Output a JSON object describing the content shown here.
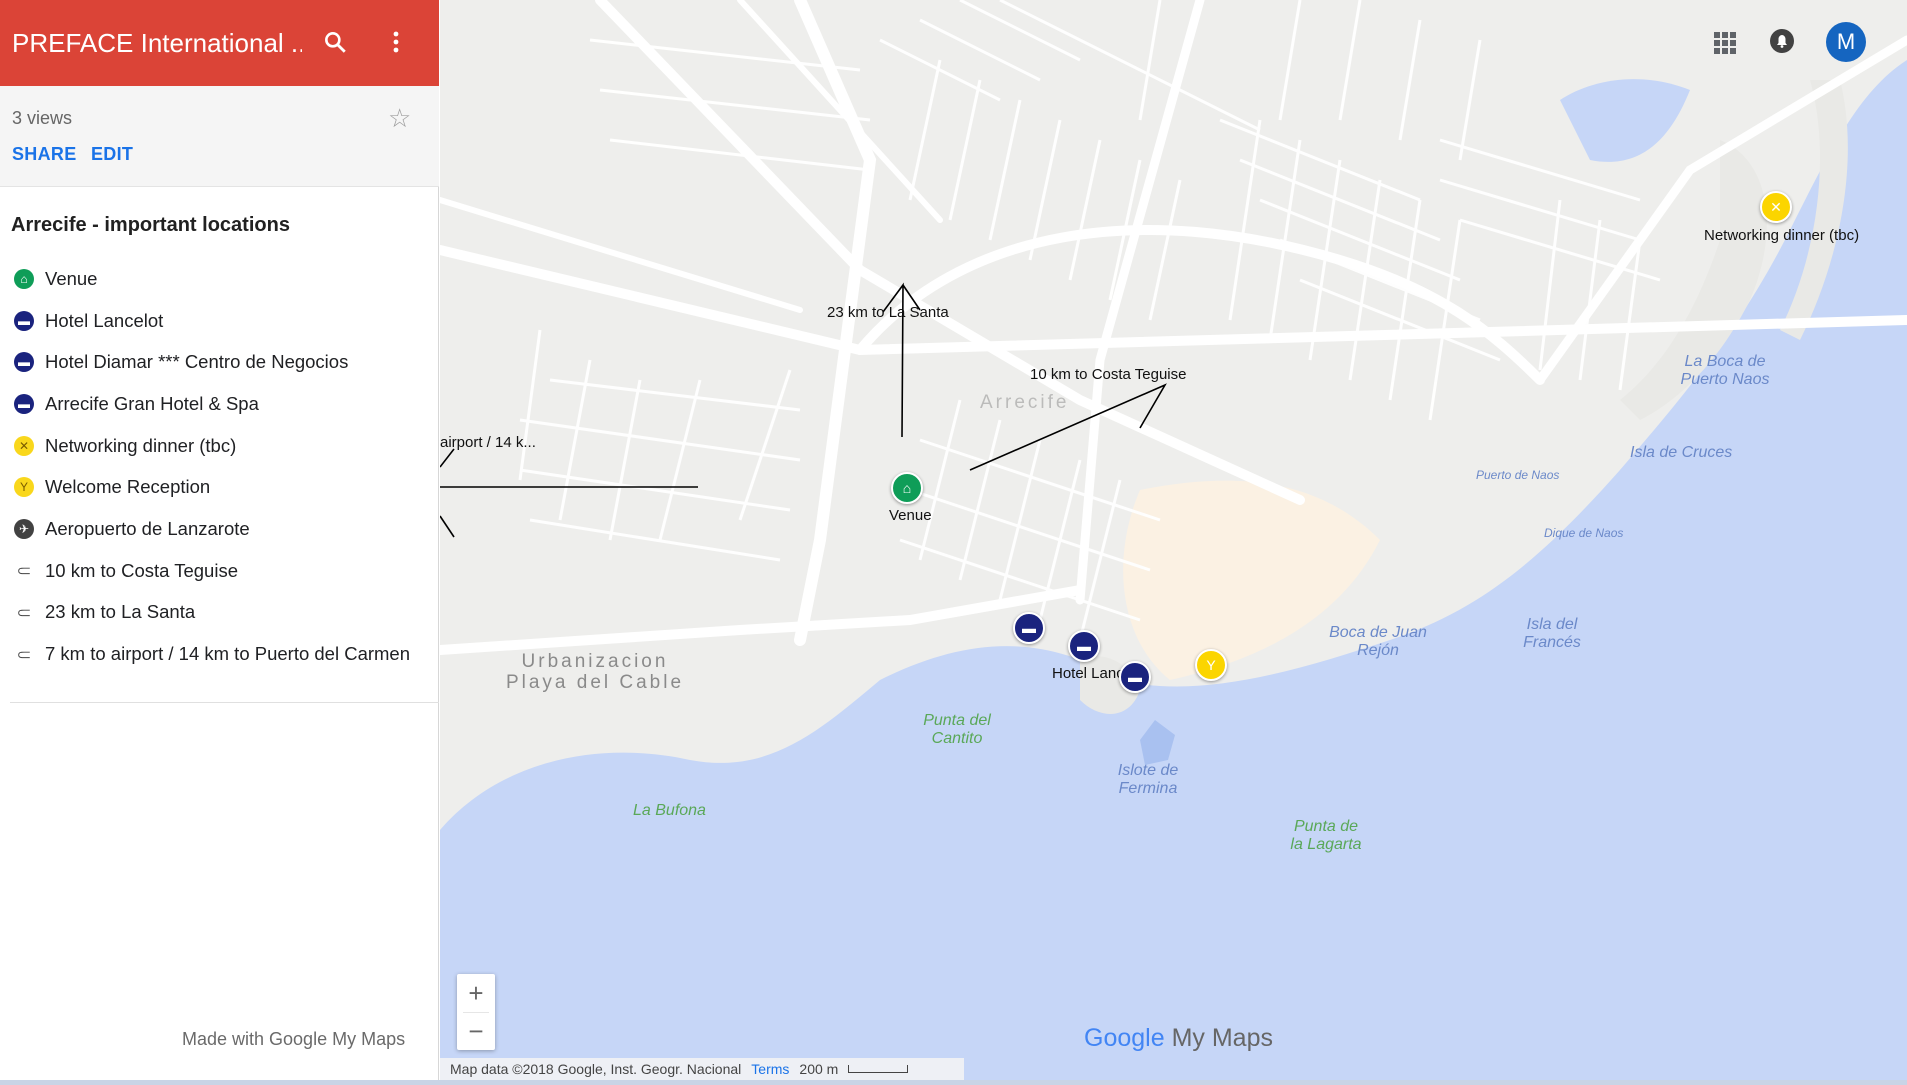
{
  "sidebar": {
    "title": "PREFACE International ...",
    "views": "3 views",
    "share_label": "SHARE",
    "edit_label": "EDIT",
    "layer_title": "Arrecife - important locations",
    "items": [
      {
        "label": "Venue",
        "icon": "home-icon"
      },
      {
        "label": "Hotel Lancelot",
        "icon": "bed-icon"
      },
      {
        "label": "Hotel Diamar *** Centro de Negocios",
        "icon": "bed-icon"
      },
      {
        "label": "Arrecife Gran Hotel & Spa",
        "icon": "bed-icon"
      },
      {
        "label": "Networking dinner (tbc)",
        "icon": "restaurant-icon"
      },
      {
        "label": "Welcome Reception",
        "icon": "cocktail-icon"
      },
      {
        "label": "Aeropuerto de Lanzarote",
        "icon": "airplane-icon"
      },
      {
        "label": "10 km to Costa Teguise",
        "icon": "route-icon"
      },
      {
        "label": "23 km to La Santa",
        "icon": "route-icon"
      },
      {
        "label": "7 km to airport / 14 km to Puerto del Carmen",
        "icon": "route-icon"
      }
    ],
    "made_with": "Made with Google My Maps"
  },
  "map": {
    "user_initial": "M",
    "labels": {
      "la_santa": "23 km to La Santa",
      "costa_teguise": "10 km to Costa Teguise",
      "airport": "airport / 14 k...",
      "venue": "Venue",
      "hotel_lancelot": "Hotel Lancelot",
      "networking": "Networking dinner (tbc)"
    },
    "places": {
      "arrecife": "Arrecife",
      "urbanizacion": "Urbanizacion Playa del Cable",
      "la_boca": "La Boca de Puerto Naos",
      "isla_cruces": "Isla de Cruces",
      "puerto_naos": "Puerto de Naos",
      "dique": "Dique de Naos",
      "boca_juan": "Boca de Juan Rejón",
      "isla_frances": "Isla del Francés",
      "punta_cantito": "Punta del Cantito",
      "islote": "Islote de Fermina",
      "punta_lagarta": "Punta de la Lagarta",
      "la_bufona": "La Bufona"
    },
    "zoom_in": "+",
    "zoom_out": "−",
    "brand_google": "Google",
    "brand_mymaps": "My Maps",
    "attribution": "Map data ©2018 Google, Inst. Geogr. Nacional",
    "terms": "Terms",
    "scale": "200 m"
  },
  "colors": {
    "header": "#db4437",
    "water": "#c6d6f7",
    "venue": "#0f9d58",
    "hotel": "#1a237e",
    "food_drink": "#fbd500"
  }
}
